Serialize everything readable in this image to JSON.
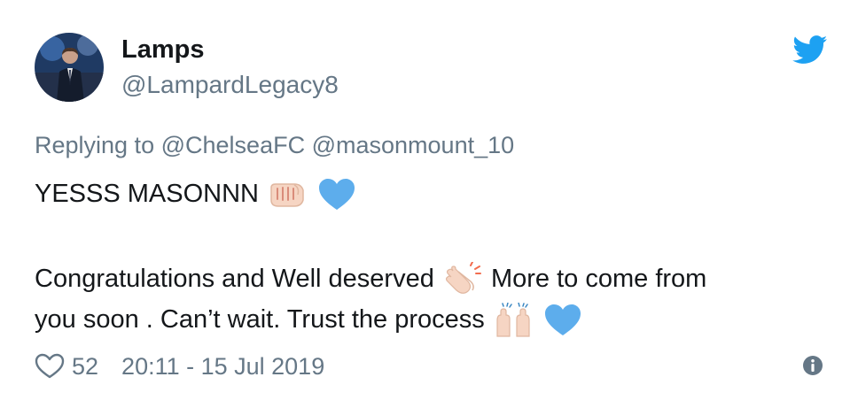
{
  "user": {
    "display_name": "Lamps",
    "handle": "@LampardLegacy8"
  },
  "reply": {
    "prefix": "Replying to",
    "mentions": [
      "@ChelseaFC",
      "@masonmount_10"
    ]
  },
  "tweet": {
    "line1": "YESSS MASONNN",
    "line2_part1": "Congratulations and Well deserved",
    "line2_part2": "More to come from",
    "line3": "you soon . Can’t wait. Trust the process"
  },
  "footer": {
    "likes": "52",
    "timestamp": "20:11 - 15 Jul 2019"
  },
  "icons": {
    "logo": "twitter-bird-icon",
    "like": "heart-outline-icon",
    "info": "info-icon",
    "emoji_1": "oncoming-fist-emoji",
    "emoji_2": "blue-heart-emoji",
    "emoji_3": "clapping-hands-emoji",
    "emoji_4": "raising-hands-emoji"
  },
  "colors": {
    "text": "#14171a",
    "secondary": "#657786",
    "brand": "#1da1f2",
    "blue_heart": "#5dadec"
  }
}
